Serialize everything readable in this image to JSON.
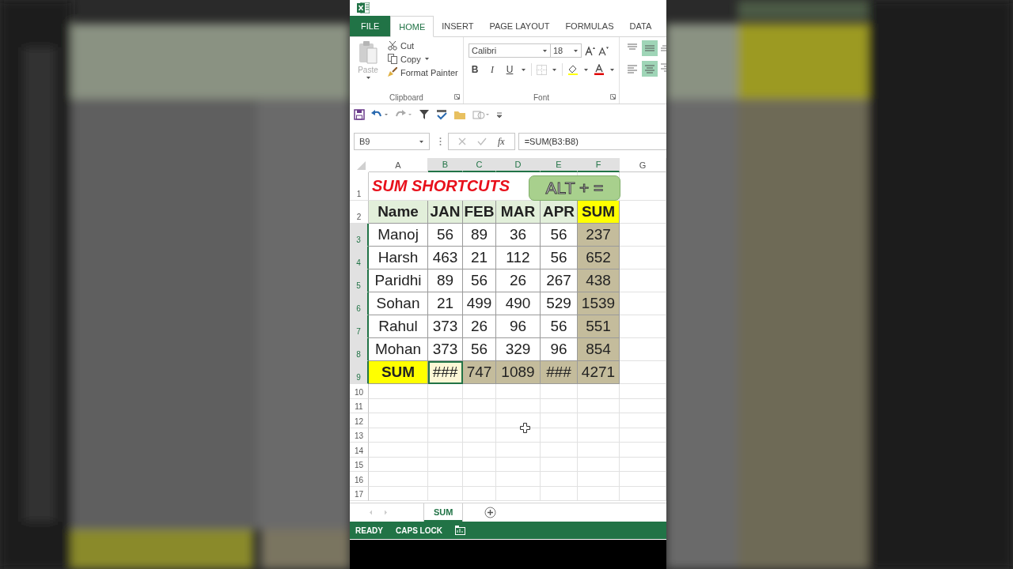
{
  "tabs": [
    {
      "label": "FILE",
      "kind": "file",
      "selected": false
    },
    {
      "label": "HOME",
      "kind": "tab",
      "selected": true
    },
    {
      "label": "INSERT",
      "kind": "tab",
      "selected": false
    },
    {
      "label": "PAGE LAYOUT",
      "kind": "tab",
      "selected": false
    },
    {
      "label": "FORMULAS",
      "kind": "tab",
      "selected": false
    },
    {
      "label": "DATA",
      "kind": "tab",
      "selected": false
    }
  ],
  "ribbon": {
    "clipboard": {
      "paste": {
        "label": "Paste",
        "disabled": true
      },
      "items": [
        {
          "label": "Cut",
          "kind": "cut"
        },
        {
          "label": "Copy",
          "kind": "copy"
        },
        {
          "label": "Format Painter",
          "kind": "painter"
        }
      ],
      "label": "Clipboard"
    },
    "font": {
      "name": "Calibri",
      "size": "18",
      "format_buttons": [
        {
          "label": "B",
          "kind": "bold"
        },
        {
          "label": "I",
          "kind": "italic"
        },
        {
          "label": "U",
          "kind": "underline"
        }
      ],
      "label": "Font"
    },
    "alignment": [
      {
        "kind": "top",
        "selected": false
      },
      {
        "kind": "middle",
        "selected": true
      },
      {
        "kind": "left",
        "selected": false
      },
      {
        "kind": "center",
        "selected": true
      }
    ]
  },
  "formula_bar": {
    "name_box": "B9",
    "function_label": "fx",
    "formula": "=SUM(B3:B8)"
  },
  "sheet": {
    "columns": [
      {
        "label": "A",
        "selected": false
      },
      {
        "label": "B",
        "selected": true
      },
      {
        "label": "C",
        "selected": true
      },
      {
        "label": "D",
        "selected": true
      },
      {
        "label": "E",
        "selected": true
      },
      {
        "label": "F",
        "selected": true
      },
      {
        "label": "G",
        "selected": false
      }
    ],
    "title": "SUM SHORTCUTS",
    "shortcut_badge": "ALT + =",
    "rows": [
      {
        "number": "1",
        "kind": "title",
        "selected": false
      },
      {
        "number": "2",
        "kind": "data",
        "selected": false,
        "cells": [
          {
            "text": "Name",
            "kind": "header",
            "selected": false
          },
          {
            "text": "JAN",
            "kind": "header",
            "selected": false
          },
          {
            "text": "FEB",
            "kind": "header",
            "selected": false
          },
          {
            "text": "MAR",
            "kind": "header",
            "selected": false
          },
          {
            "text": "APR",
            "kind": "header",
            "selected": false
          },
          {
            "text": "SUM",
            "kind": "highlight",
            "selected": false
          }
        ]
      },
      {
        "number": "3",
        "kind": "data",
        "selected": true,
        "cells": [
          {
            "text": "Manoj",
            "kind": "plain",
            "selected": false
          },
          {
            "text": "56",
            "kind": "plain",
            "selected": false
          },
          {
            "text": "89",
            "kind": "plain",
            "selected": false
          },
          {
            "text": "36",
            "kind": "plain",
            "selected": false
          },
          {
            "text": "56",
            "kind": "plain",
            "selected": false
          },
          {
            "text": "237",
            "kind": "plain",
            "selected": true
          }
        ]
      },
      {
        "number": "4",
        "kind": "data",
        "selected": true,
        "cells": [
          {
            "text": "Harsh",
            "kind": "plain",
            "selected": false
          },
          {
            "text": "463",
            "kind": "plain",
            "selected": false
          },
          {
            "text": "21",
            "kind": "plain",
            "selected": false
          },
          {
            "text": "112",
            "kind": "plain",
            "selected": false
          },
          {
            "text": "56",
            "kind": "plain",
            "selected": false
          },
          {
            "text": "652",
            "kind": "plain",
            "selected": true
          }
        ]
      },
      {
        "number": "5",
        "kind": "data",
        "selected": true,
        "cells": [
          {
            "text": "Paridhi",
            "kind": "plain",
            "selected": false
          },
          {
            "text": "89",
            "kind": "plain",
            "selected": false
          },
          {
            "text": "56",
            "kind": "plain",
            "selected": false
          },
          {
            "text": "26",
            "kind": "plain",
            "selected": false
          },
          {
            "text": "267",
            "kind": "plain",
            "selected": false
          },
          {
            "text": "438",
            "kind": "plain",
            "selected": true
          }
        ]
      },
      {
        "number": "6",
        "kind": "data",
        "selected": true,
        "cells": [
          {
            "text": "Sohan",
            "kind": "plain",
            "selected": false
          },
          {
            "text": "21",
            "kind": "plain",
            "selected": false
          },
          {
            "text": "499",
            "kind": "plain",
            "selected": false
          },
          {
            "text": "490",
            "kind": "plain",
            "selected": false
          },
          {
            "text": "529",
            "kind": "plain",
            "selected": false
          },
          {
            "text": "1539",
            "kind": "plain",
            "selected": true
          }
        ]
      },
      {
        "number": "7",
        "kind": "data",
        "selected": true,
        "cells": [
          {
            "text": "Rahul",
            "kind": "plain",
            "selected": false
          },
          {
            "text": "373",
            "kind": "plain",
            "selected": false
          },
          {
            "text": "26",
            "kind": "plain",
            "selected": false
          },
          {
            "text": "96",
            "kind": "plain",
            "selected": false
          },
          {
            "text": "56",
            "kind": "plain",
            "selected": false
          },
          {
            "text": "551",
            "kind": "plain",
            "selected": true
          }
        ]
      },
      {
        "number": "8",
        "kind": "data",
        "selected": true,
        "cells": [
          {
            "text": "Mohan",
            "kind": "plain",
            "selected": false
          },
          {
            "text": "373",
            "kind": "plain",
            "selected": false
          },
          {
            "text": "56",
            "kind": "plain",
            "selected": false
          },
          {
            "text": "329",
            "kind": "plain",
            "selected": false
          },
          {
            "text": "96",
            "kind": "plain",
            "selected": false
          },
          {
            "text": "854",
            "kind": "plain",
            "selected": true
          }
        ]
      },
      {
        "number": "9",
        "kind": "data",
        "selected": true,
        "cells": [
          {
            "text": "SUM",
            "kind": "highlight",
            "selected": false
          },
          {
            "text": "###",
            "kind": "active",
            "selected": true
          },
          {
            "text": "747",
            "kind": "plain",
            "selected": true
          },
          {
            "text": "1089",
            "kind": "plain",
            "selected": true
          },
          {
            "text": "###",
            "kind": "plain",
            "selected": true
          },
          {
            "text": "4271",
            "kind": "plain",
            "selected": true
          }
        ]
      },
      {
        "number": "10",
        "kind": "empty",
        "selected": false
      },
      {
        "number": "11",
        "kind": "empty",
        "selected": false
      },
      {
        "number": "12",
        "kind": "empty",
        "selected": false
      },
      {
        "number": "13",
        "kind": "empty",
        "selected": false
      },
      {
        "number": "14",
        "kind": "empty",
        "selected": false
      },
      {
        "number": "15",
        "kind": "empty",
        "selected": false
      },
      {
        "number": "16",
        "kind": "empty",
        "selected": false
      },
      {
        "number": "17",
        "kind": "empty",
        "selected": false
      }
    ]
  },
  "sheet_tabs": [
    {
      "label": "SUM",
      "selected": true
    }
  ],
  "status_bar": {
    "items": [
      "READY",
      "CAPS LOCK"
    ]
  }
}
